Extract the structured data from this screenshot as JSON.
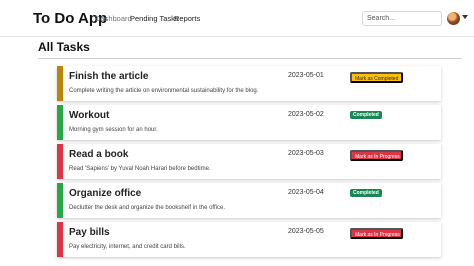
{
  "app": {
    "brand": "To Do App"
  },
  "nav": {
    "items": [
      "Dashboard",
      "Pending Tasks",
      "Reports"
    ]
  },
  "search": {
    "placeholder": "Search..."
  },
  "page": {
    "title": "All Tasks"
  },
  "colors": {
    "warning": "#ffc107",
    "success": "#28a745",
    "danger": "#dc3545"
  },
  "tasks": [
    {
      "title": "Finish the article",
      "description": "Complete writing the article on environmental sustainability for the blog.",
      "date": "2023-05-01",
      "status": "Mark as Completed",
      "status_type": "warning",
      "bar_color": "#b8860b"
    },
    {
      "title": "Workout",
      "description": "Morning gym session for an hour.",
      "date": "2023-05-02",
      "status": "Completed",
      "status_type": "success",
      "bar_color": "#28a745"
    },
    {
      "title": "Read a book",
      "description": "Read 'Sapiens' by Yuval Noah Harari before bedtime.",
      "date": "2023-05-03",
      "status": "Mark as In Progress",
      "status_type": "danger",
      "bar_color": "#dc3545"
    },
    {
      "title": "Organize office",
      "description": "Declutter the desk and organize the bookshelf in the office.",
      "date": "2023-05-04",
      "status": "Completed",
      "status_type": "success",
      "bar_color": "#28a745"
    },
    {
      "title": "Pay bills",
      "description": "Pay electricity, internet, and credit card bills.",
      "date": "2023-05-05",
      "status": "Mark as In Progress",
      "status_type": "danger",
      "bar_color": "#dc3545"
    }
  ]
}
